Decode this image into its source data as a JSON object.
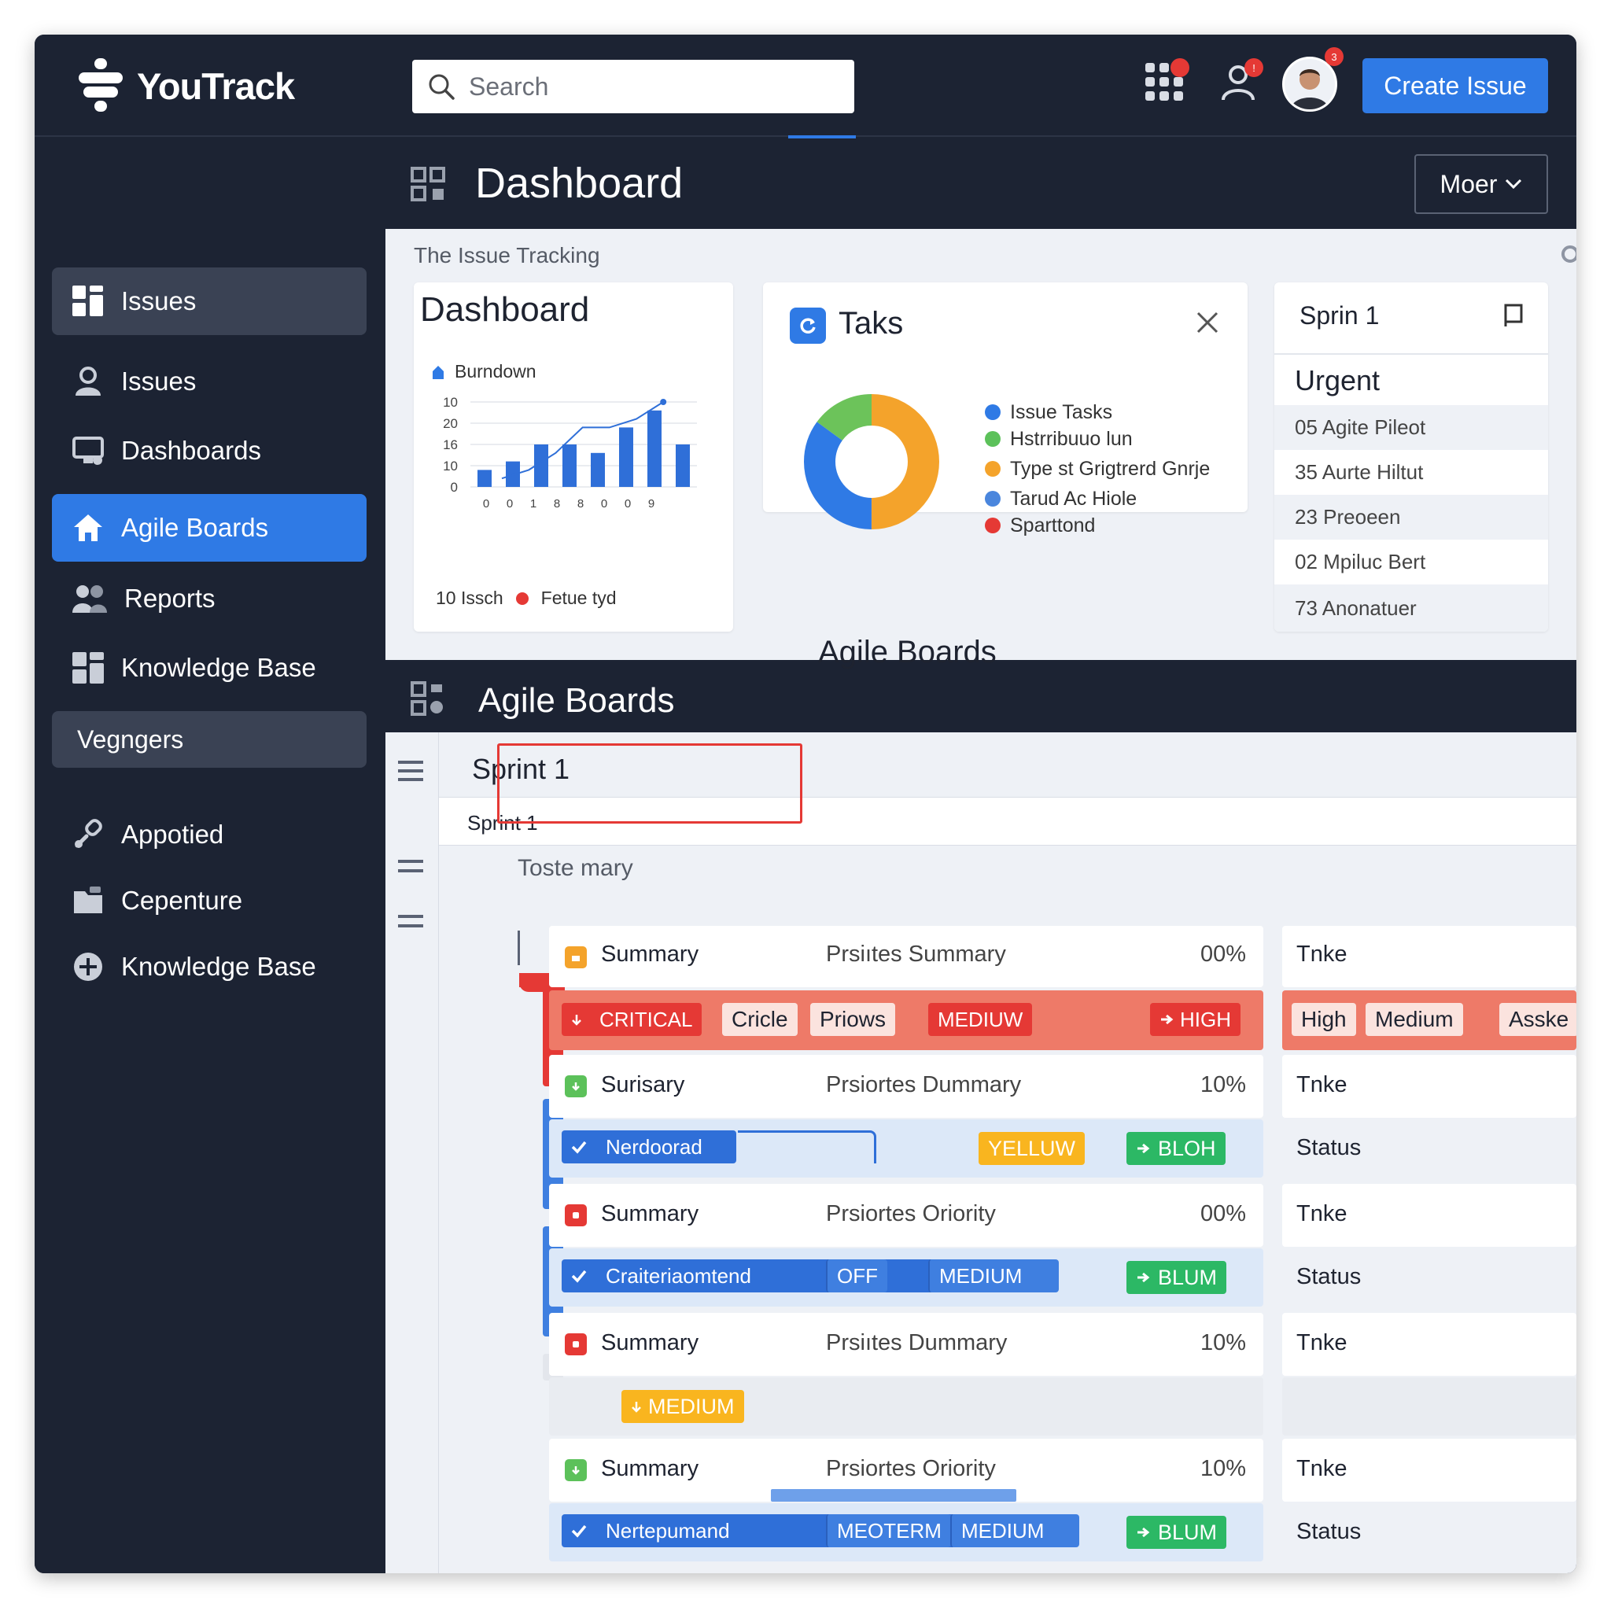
{
  "app": {
    "name": "YouTrack"
  },
  "header": {
    "search_placeholder": "Search",
    "notification_badge": "",
    "user_badge": "!",
    "avatar_badge": "3",
    "create_issue": "Create Issue"
  },
  "sidebar": {
    "items": [
      {
        "label": "Issues",
        "icon": "grid-icon"
      },
      {
        "label": "Issues",
        "icon": "person-icon"
      },
      {
        "label": "Dashboards",
        "icon": "monitor-icon"
      },
      {
        "label": "Agile Boards",
        "icon": "home-icon"
      },
      {
        "label": "Reports",
        "icon": "people-icon"
      },
      {
        "label": "Knowledge Base",
        "icon": "blocks-icon"
      }
    ],
    "section": "Vegngers",
    "section_items": [
      {
        "label": "Appotied",
        "icon": "link-icon"
      },
      {
        "label": "Cepenture",
        "icon": "folder-icon"
      },
      {
        "label": "Knowledge Base",
        "icon": "plus-icon"
      }
    ]
  },
  "page": {
    "title": "Dashboard",
    "more": "Moer"
  },
  "dashboard": {
    "panel_title": "The Issue Tracking",
    "card1": {
      "title": "Dashboard",
      "chart_label": "Burndown",
      "footer_left": "10 Issch",
      "footer_right": "Fetue tyd"
    },
    "card2": {
      "title": "Taks",
      "legend": [
        {
          "label": "Issue Tasks",
          "color": "#2f7ae5"
        },
        {
          "label": "Hstrribuuo lun",
          "color": "#5cc15a"
        },
        {
          "label": "Type st Grigtrerd Gnrje",
          "color": "#f4a32b"
        },
        {
          "label": "Tarud Ac Hiole",
          "color": "#4a86dd"
        },
        {
          "label": "Sparttond",
          "color": "#e53935"
        }
      ]
    },
    "card3": {
      "title": "Sprin 1",
      "heading": "Urgent",
      "rows": [
        "05 Agite Pileot",
        "35 Aurte Hiltut",
        "23 Preoeen",
        "02 Mpiluc Bert",
        "73 Anonatuer"
      ]
    },
    "subheading": "Agile Boards"
  },
  "chart_data": {
    "type": "bar",
    "title": "Burndown",
    "y_ticks": [
      "10",
      "20",
      "16",
      "10",
      "0"
    ],
    "x_ticks": [
      "0",
      "0",
      "1",
      "8",
      "8",
      "0",
      "0",
      "9"
    ],
    "series": [
      {
        "type": "bar",
        "values": [
          2,
          3,
          5,
          5,
          4,
          7,
          9,
          5
        ]
      },
      {
        "type": "line",
        "values": [
          1,
          2,
          4,
          7,
          7,
          8,
          10
        ]
      }
    ]
  },
  "donut": {
    "slices": [
      {
        "value": 50,
        "color": "#f4a32b"
      },
      {
        "value": 35,
        "color": "#2f7ae5"
      },
      {
        "value": 15,
        "color": "#6cc35a"
      }
    ]
  },
  "board": {
    "title": "Agile Boards",
    "sprint_title": "Sprint 1",
    "sprint_sub": "Sprint 1",
    "swimlane": "Toste mary",
    "rows": [
      {
        "icon_color": "#f4a32b",
        "summary": "Summary",
        "desc": "Prsiıtes Summary",
        "pct": "00%",
        "right": "Tnke"
      },
      {
        "icon_color": "#5cc15a",
        "summary": "Surisary",
        "desc": "Prsiortes Dummary",
        "pct": "10%",
        "right": "Tnke"
      },
      {
        "icon_color": "#e53935",
        "summary": "Summary",
        "desc": "Prsiortes Oriority",
        "pct": "00%",
        "right": "Tnke"
      },
      {
        "icon_color": "#e53935",
        "summary": "Summary",
        "desc": "Prsiıtes Dummary",
        "pct": "10%",
        "right": "Tnke"
      },
      {
        "icon_color": "#5cc15a",
        "summary": "Summary",
        "desc": "Prsiortes Oriority",
        "pct": "10%",
        "right": "Tnke"
      }
    ],
    "tags_row1": {
      "critical": "CRITICAL",
      "cricle": "Cricle",
      "priows": "Priows",
      "mediuw": "MEDIUW",
      "high": "HIGH"
    },
    "tags_row1_right": [
      "High",
      "Medium",
      "Asske"
    ],
    "tags_row2": {
      "name": "Nerdoorad",
      "yellow": "YELLUW",
      "bloh": "BLOH",
      "right": "Status"
    },
    "tags_row3": {
      "name": "Craiteriaomtend",
      "off": "OFF",
      "medium": "MEDIUM",
      "blum": "BLUM",
      "right": "Status"
    },
    "tags_row4": {
      "medium": "MEDIUM"
    },
    "tags_row5": {
      "name": "Nertepumand",
      "meoterm": "MEOTERM",
      "medium": "MEDIUM",
      "blum": "BLUM",
      "right": "Status"
    }
  }
}
